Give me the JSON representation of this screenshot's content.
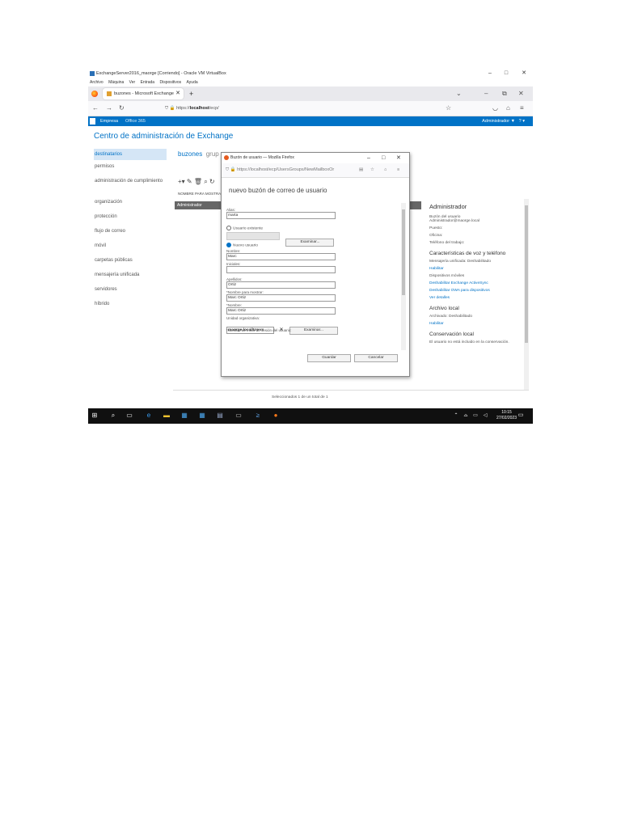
{
  "vbox": {
    "title": "ExchangeServer2016_maorge [Corriendo] - Oracle VM VirtualBox",
    "menu": [
      "Archivo",
      "Máquina",
      "Ver",
      "Entrada",
      "Dispositivos",
      "Ayuda"
    ]
  },
  "firefox": {
    "tab_title": "buzones - Microsoft Exchange",
    "url_prefix": "https://",
    "url_host": "localhost",
    "url_path": "/ecp/"
  },
  "exchange": {
    "bar_tab1": "Empresa",
    "bar_tab2": "Office 365",
    "admin_menu": "Administrador ▼",
    "help": "? ▾",
    "title": "Centro de administración de Exchange",
    "nav": [
      "destinatarios",
      "permisos",
      "administración de cumplimiento",
      "organización",
      "protección",
      "flujo de correo",
      "móvil",
      "carpetas públicas",
      "mensajería unificada",
      "servidores",
      "híbrido"
    ],
    "subtab_active": "buzones",
    "subtab_next": "grup",
    "toolbar": "+▾ ✎ 🗑 ⌕ ↻",
    "column_header": "NOMBRE PARA MOSTRAR",
    "selected_row": "Administrador",
    "status": "Seleccionados 1 de un total de 1"
  },
  "details": {
    "name": "Administrador",
    "mailbox_user_label": "Buzón del usuario",
    "mailbox_user_value": "Administrador@maorge.local",
    "position": "Puesto:",
    "office": "Oficina:",
    "phone": "Teléfono del trabajo:",
    "voice_heading": "Características de voz y teléfono",
    "um_status": "Mensajería unificada: Deshabilitado",
    "um_enable": "Habilitar",
    "mobile_label": "Dispositivos móviles",
    "disable_activesync": "Deshabilitar Exchange ActiveSync",
    "disable_owa": "Deshabilitar OWA para dispositivos",
    "view_details": "Ver detalles",
    "archive_heading": "Archivo local",
    "archive_status": "Archivado: Deshabilitado",
    "archive_enable": "Habilitar",
    "retention_heading": "Conservación local",
    "retention_text": "El usuario no está incluido en la conservación."
  },
  "dialog": {
    "title": "Buzón de usuario — Mozilla Firefox",
    "url": "https://localhost/ecp/UsersGroups/NewMailboxOr",
    "heading": "nuevo buzón de correo de usuario",
    "alias_label": "Alias:",
    "alias_value": "marta",
    "existing_user": "Usuario existente",
    "browse": "Examinar...",
    "new_user": "Nuevo usuario",
    "first_name_label": "Nombre:",
    "first_name_value": "Marc",
    "initials_label": "Iniciales:",
    "last_name_label": "Apellidos:",
    "last_name_value": "Ortiz",
    "display_name_label": "*Nombre para mostrar:",
    "display_name_value": "Marc Ortiz",
    "name_label": "*Nombre:",
    "name_value": "Marc Ortiz",
    "ou_label": "Unidad organizativa:",
    "ou_value": "maorge.local/Users",
    "clear_x": "✕",
    "logon_label": "*Nombre de inicio de sesión del usuario:",
    "save": "Guardar",
    "cancel": "Cancelar"
  },
  "taskbar": {
    "time": "10:15",
    "date": "27/02/2023"
  }
}
